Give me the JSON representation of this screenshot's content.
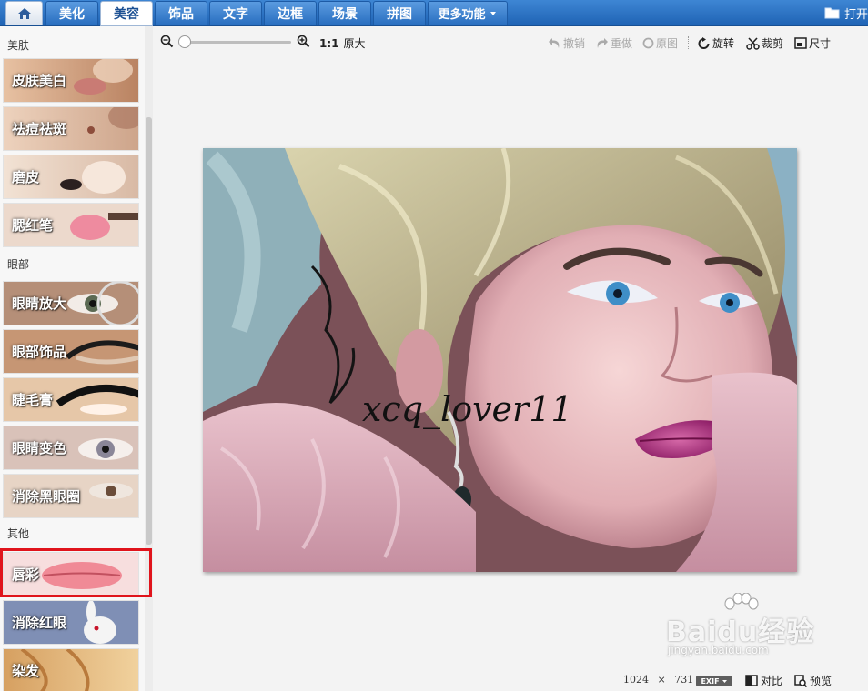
{
  "nav": {
    "tabs": [
      {
        "label": "美化"
      },
      {
        "label": "美容"
      },
      {
        "label": "饰品"
      },
      {
        "label": "文字"
      },
      {
        "label": "边框"
      },
      {
        "label": "场景"
      },
      {
        "label": "拼图"
      },
      {
        "label": "更多功能"
      }
    ],
    "active_tab": "美容",
    "open_label": "打开"
  },
  "sidebar": {
    "sections": [
      {
        "title": "美肤",
        "items": [
          {
            "label": "皮肤美白"
          },
          {
            "label": "祛痘祛斑"
          },
          {
            "label": "磨皮"
          },
          {
            "label": "腮红笔"
          }
        ]
      },
      {
        "title": "眼部",
        "items": [
          {
            "label": "眼睛放大"
          },
          {
            "label": "眼部饰品"
          },
          {
            "label": "睫毛膏"
          },
          {
            "label": "眼睛变色"
          },
          {
            "label": "消除黑眼圈"
          }
        ]
      },
      {
        "title": "其他",
        "items": [
          {
            "label": "唇彩"
          },
          {
            "label": "消除红眼"
          },
          {
            "label": "染发"
          }
        ]
      }
    ],
    "selected_item": "唇彩"
  },
  "toolbar": {
    "ratio_label": "1:1",
    "original_size_label": "原大",
    "undo_label": "撤销",
    "redo_label": "重做",
    "reset_label": "原图",
    "rotate_label": "旋转",
    "crop_label": "裁剪",
    "resize_label": "尺寸"
  },
  "photo": {
    "watermark_text": "xcq_lover11"
  },
  "status": {
    "width": "1024",
    "times": "×",
    "height": "731",
    "exif_label": "EXIF",
    "compare_label": "对比",
    "preview_label": "预览"
  },
  "watermark": {
    "brand": "Baidu经验",
    "url": "jingyan.baidu.com"
  },
  "colors": {
    "nav_blue": "#2a6fc0",
    "highlight_red": "#e0141c",
    "lips": "#b0237a"
  }
}
